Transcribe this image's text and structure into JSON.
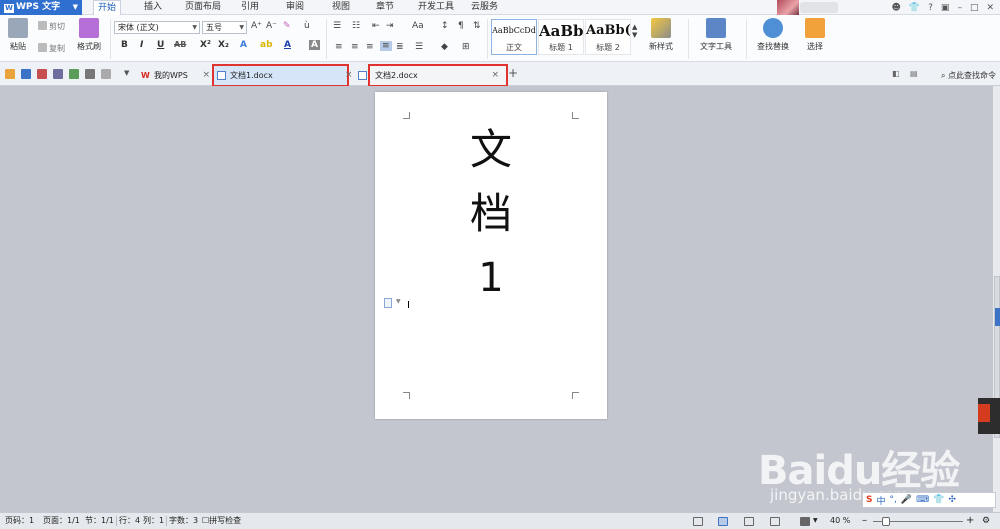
{
  "app": {
    "name": "WPS 文字",
    "logo": "W"
  },
  "menu": {
    "tabs": [
      "开始",
      "插入",
      "页面布局",
      "引用",
      "审阅",
      "视图",
      "章节",
      "开发工具",
      "云服务"
    ],
    "active": "开始"
  },
  "ribbon": {
    "paste": "粘贴",
    "cut": "剪切",
    "copy": "复制",
    "format_painter": "格式刷",
    "font_name": "宋体 (正文)",
    "font_size": "五号",
    "styles": [
      {
        "sample": "AaBbCcDd",
        "label": "正文"
      },
      {
        "sample": "AaBb",
        "label": "标题 1"
      },
      {
        "sample": "AaBb(",
        "label": "标题 2"
      }
    ],
    "new_style": "新样式",
    "text_tools": "文字工具",
    "find_replace": "查找替换",
    "select": "选择"
  },
  "tabs": {
    "my_wps": "我的WPS",
    "doc1": "文档1.docx",
    "doc2": "文档2.docx",
    "command_search": "点此查找命令"
  },
  "document": {
    "lines": [
      "文",
      "档",
      "1"
    ]
  },
  "watermark": {
    "brand": "Baidu经验",
    "url": "jingyan.baidu.com"
  },
  "status": {
    "page_code": "页码：1",
    "pages": "页面：1/1",
    "section": "节：1/1",
    "row": "行：4",
    "col": "列：1",
    "words": "字数：3",
    "spellcheck": "拼写检查",
    "zoom": "40 %"
  },
  "colors": {
    "app_blue": "#2f6fcf",
    "highlight_red": "#e0322e"
  }
}
